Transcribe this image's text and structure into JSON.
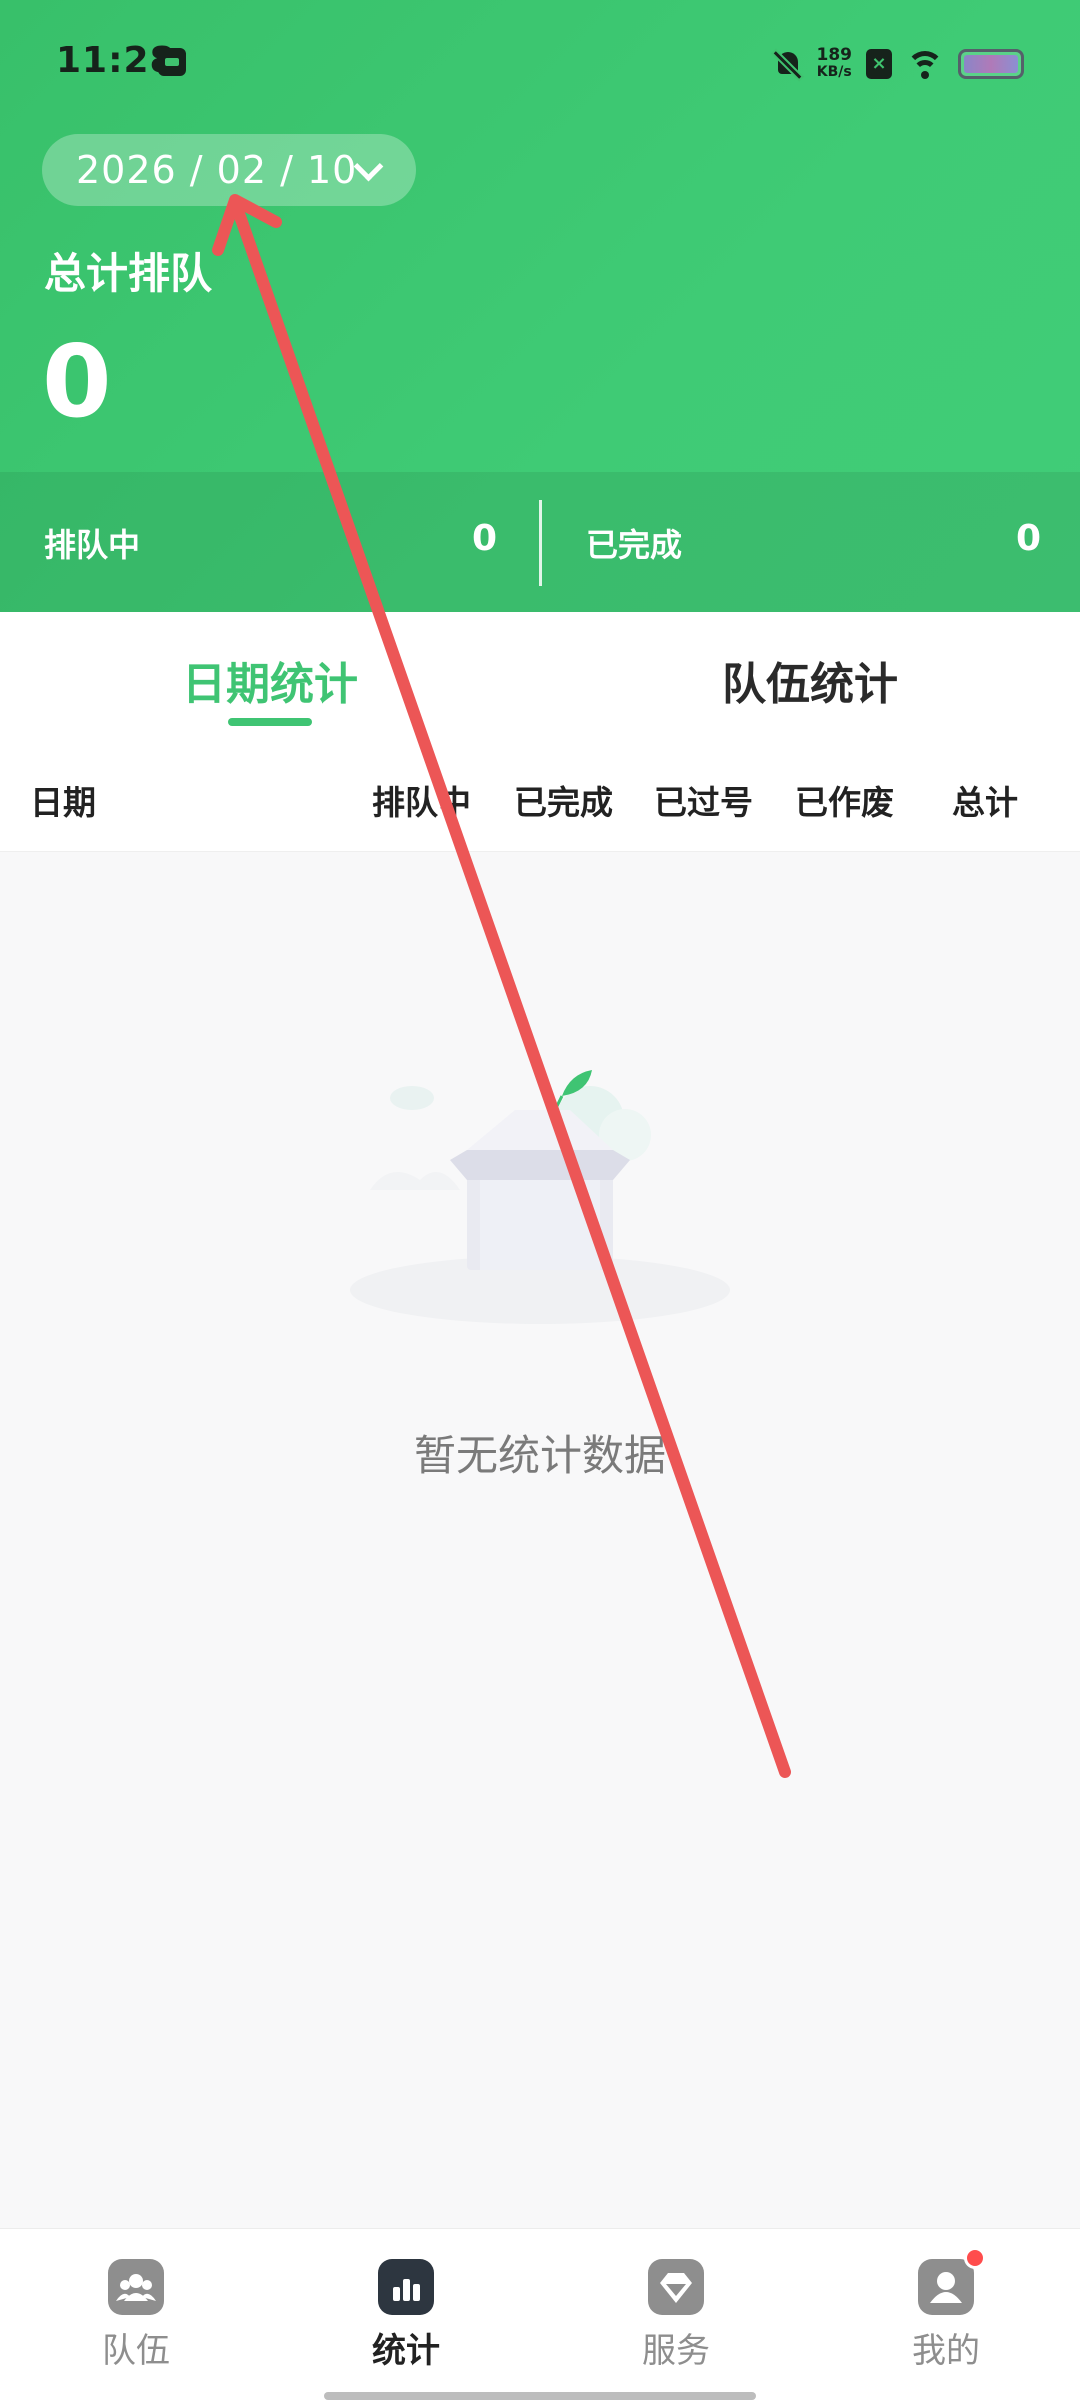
{
  "status_bar": {
    "time": "11:28",
    "speed_value": "189",
    "speed_unit": "KB/s",
    "sim_label": "×",
    "icons": [
      "app-notification-icon",
      "mute-icon",
      "sim-icon",
      "wifi-icon",
      "battery-icon"
    ]
  },
  "header": {
    "date": "2026 / 02 / 10",
    "total_title": "总计排队",
    "total_value": "0",
    "summary": {
      "queuing_label": "排队中",
      "queuing_value": "0",
      "completed_label": "已完成",
      "completed_value": "0"
    },
    "colors": {
      "green": "#3fc473",
      "green_dark": "#38c06a"
    }
  },
  "tabs": [
    {
      "label": "日期统计",
      "active": true
    },
    {
      "label": "队伍统计",
      "active": false
    }
  ],
  "table": {
    "columns": [
      "日期",
      "排队中",
      "已完成",
      "已过号",
      "已作废",
      "总计"
    ],
    "rows": []
  },
  "empty_state": {
    "icon": "empty-box-icon",
    "text": "暂无统计数据"
  },
  "annotation": {
    "type": "arrow",
    "color": "#ec5656"
  },
  "bottom_nav": [
    {
      "label": "队伍",
      "icon": "team-icon",
      "active": false,
      "badge": false
    },
    {
      "label": "统计",
      "icon": "chart-icon",
      "active": true,
      "badge": false
    },
    {
      "label": "服务",
      "icon": "diamond-icon",
      "active": false,
      "badge": false
    },
    {
      "label": "我的",
      "icon": "profile-icon",
      "active": false,
      "badge": true
    }
  ]
}
